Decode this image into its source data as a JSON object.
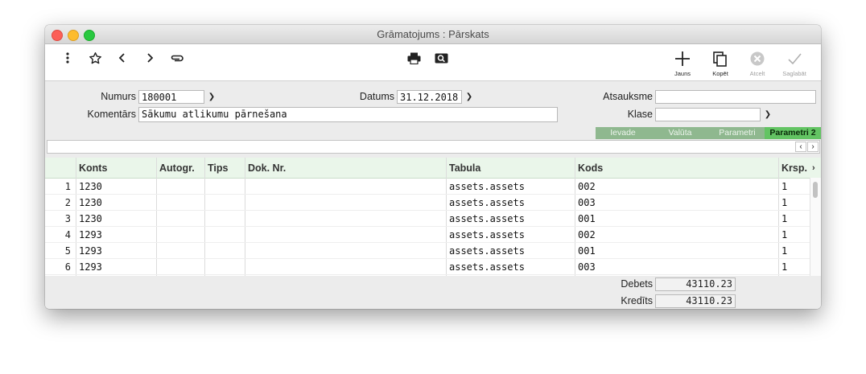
{
  "window": {
    "title": "Grāmatojums : Pārskats"
  },
  "toolbar": {
    "icons": [
      "more-vertical-icon",
      "star-icon",
      "chevron-left-icon",
      "chevron-right-icon",
      "paperclip-icon",
      "printer-icon",
      "search-icon"
    ],
    "actions": {
      "new_label": "Jauns",
      "copy_label": "Kopēt",
      "cancel_label": "Atcelt",
      "save_label": "Saglabāt"
    }
  },
  "form": {
    "numurs_label": "Numurs",
    "numurs_value": "180001",
    "datums_label": "Datums",
    "datums_value": "31.12.2018",
    "atsauksme_label": "Atsauksme",
    "atsauksme_value": "",
    "komentars_label": "Komentārs",
    "komentars_value": "Sākumu atlikumu pārnešana",
    "klase_label": "Klase",
    "klase_value": ""
  },
  "tabs": [
    "Ievade",
    "Valūta",
    "Parametri",
    "Parametri 2"
  ],
  "active_tab": "Parametri 2",
  "table": {
    "columns": [
      "Konts",
      "Autogr.",
      "Tips",
      "Dok. Nr.",
      "Tabula",
      "Kods",
      "Krsp."
    ],
    "rows": [
      {
        "n": "1",
        "konts": "1230",
        "autogr": "",
        "tips": "",
        "dok": "",
        "tabula": "assets.assets",
        "kods": "002",
        "krsp": "1"
      },
      {
        "n": "2",
        "konts": "1230",
        "autogr": "",
        "tips": "",
        "dok": "",
        "tabula": "assets.assets",
        "kods": "003",
        "krsp": "1"
      },
      {
        "n": "3",
        "konts": "1230",
        "autogr": "",
        "tips": "",
        "dok": "",
        "tabula": "assets.assets",
        "kods": "001",
        "krsp": "1"
      },
      {
        "n": "4",
        "konts": "1293",
        "autogr": "",
        "tips": "",
        "dok": "",
        "tabula": "assets.assets",
        "kods": "002",
        "krsp": "1"
      },
      {
        "n": "5",
        "konts": "1293",
        "autogr": "",
        "tips": "",
        "dok": "",
        "tabula": "assets.assets",
        "kods": "001",
        "krsp": "1"
      },
      {
        "n": "6",
        "konts": "1293",
        "autogr": "",
        "tips": "",
        "dok": "",
        "tabula": "assets.assets",
        "kods": "003",
        "krsp": "1"
      }
    ]
  },
  "totals": {
    "debets_label": "Debets",
    "debets_value": "43110.23",
    "kredits_label": "Kredīts",
    "kredits_value": "43110.23"
  },
  "colors": {
    "tab_inactive": "#8fb88f",
    "tab_active": "#63c463",
    "header_bg": "#eaf6ea"
  }
}
